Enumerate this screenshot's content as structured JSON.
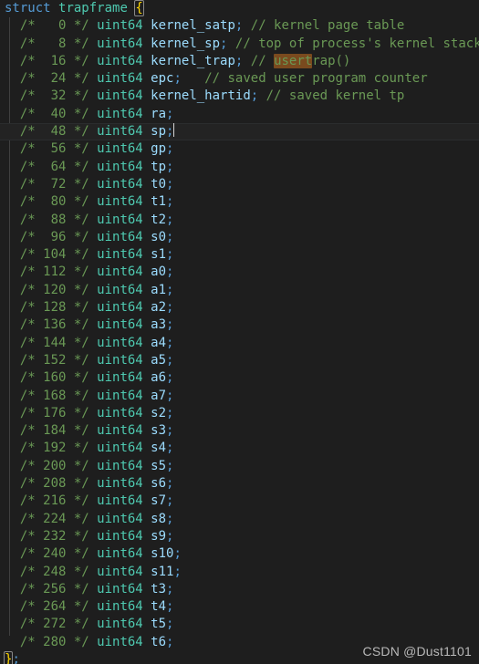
{
  "editor": {
    "language": "c",
    "theme": "dark-plus",
    "background_color": "#1e1e1e",
    "foreground_color": "#d4d4d4",
    "current_line_number": 8,
    "colors": {
      "keyword": "#569cd6",
      "type": "#4ec9b0",
      "comment": "#6a9955",
      "identifier": "#9cdcfe",
      "brace": "#ffd700",
      "find_match_background": "#7a4a1e",
      "indent_guide": "#404040",
      "current_line_border": "#2a2d2e"
    }
  },
  "header": {
    "keyword": "struct",
    "name": "trapframe",
    "open_brace": "{"
  },
  "footer": {
    "close_brace": "}",
    "semicolon": ";"
  },
  "find": {
    "match_text": "usert",
    "match_remainder": "rap()"
  },
  "fields": [
    {
      "offset": "0",
      "type": "uint64",
      "name": "kernel_satp;",
      "comment": "// kernel page table",
      "comment_col": 26,
      "current": false
    },
    {
      "offset": "8",
      "type": "uint64",
      "name": "kernel_sp;",
      "comment": "// top of process's kernel stack",
      "comment_col": 26,
      "current": false
    },
    {
      "offset": "16",
      "type": "uint64",
      "name": "kernel_trap;",
      "comment": "// usertrap()",
      "comment_col": 26,
      "current": false,
      "has_find_match": true
    },
    {
      "offset": "24",
      "type": "uint64",
      "name": "epc;",
      "comment": "// saved user program counter",
      "comment_col": 26,
      "current": false
    },
    {
      "offset": "32",
      "type": "uint64",
      "name": "kernel_hartid;",
      "comment": "// saved kernel tp",
      "comment_col": 26,
      "current": false
    },
    {
      "offset": "40",
      "type": "uint64",
      "name": "ra;",
      "comment": "",
      "comment_col": 26,
      "current": false
    },
    {
      "offset": "48",
      "type": "uint64",
      "name": "sp;",
      "comment": "",
      "comment_col": 26,
      "current": true
    },
    {
      "offset": "56",
      "type": "uint64",
      "name": "gp;",
      "comment": "",
      "comment_col": 26,
      "current": false
    },
    {
      "offset": "64",
      "type": "uint64",
      "name": "tp;",
      "comment": "",
      "comment_col": 26,
      "current": false
    },
    {
      "offset": "72",
      "type": "uint64",
      "name": "t0;",
      "comment": "",
      "comment_col": 26,
      "current": false
    },
    {
      "offset": "80",
      "type": "uint64",
      "name": "t1;",
      "comment": "",
      "comment_col": 26,
      "current": false
    },
    {
      "offset": "88",
      "type": "uint64",
      "name": "t2;",
      "comment": "",
      "comment_col": 26,
      "current": false
    },
    {
      "offset": "96",
      "type": "uint64",
      "name": "s0;",
      "comment": "",
      "comment_col": 26,
      "current": false
    },
    {
      "offset": "104",
      "type": "uint64",
      "name": "s1;",
      "comment": "",
      "comment_col": 26,
      "current": false
    },
    {
      "offset": "112",
      "type": "uint64",
      "name": "a0;",
      "comment": "",
      "comment_col": 26,
      "current": false
    },
    {
      "offset": "120",
      "type": "uint64",
      "name": "a1;",
      "comment": "",
      "comment_col": 26,
      "current": false
    },
    {
      "offset": "128",
      "type": "uint64",
      "name": "a2;",
      "comment": "",
      "comment_col": 26,
      "current": false
    },
    {
      "offset": "136",
      "type": "uint64",
      "name": "a3;",
      "comment": "",
      "comment_col": 26,
      "current": false
    },
    {
      "offset": "144",
      "type": "uint64",
      "name": "a4;",
      "comment": "",
      "comment_col": 26,
      "current": false
    },
    {
      "offset": "152",
      "type": "uint64",
      "name": "a5;",
      "comment": "",
      "comment_col": 26,
      "current": false
    },
    {
      "offset": "160",
      "type": "uint64",
      "name": "a6;",
      "comment": "",
      "comment_col": 26,
      "current": false
    },
    {
      "offset": "168",
      "type": "uint64",
      "name": "a7;",
      "comment": "",
      "comment_col": 26,
      "current": false
    },
    {
      "offset": "176",
      "type": "uint64",
      "name": "s2;",
      "comment": "",
      "comment_col": 26,
      "current": false
    },
    {
      "offset": "184",
      "type": "uint64",
      "name": "s3;",
      "comment": "",
      "comment_col": 26,
      "current": false
    },
    {
      "offset": "192",
      "type": "uint64",
      "name": "s4;",
      "comment": "",
      "comment_col": 26,
      "current": false
    },
    {
      "offset": "200",
      "type": "uint64",
      "name": "s5;",
      "comment": "",
      "comment_col": 26,
      "current": false
    },
    {
      "offset": "208",
      "type": "uint64",
      "name": "s6;",
      "comment": "",
      "comment_col": 26,
      "current": false
    },
    {
      "offset": "216",
      "type": "uint64",
      "name": "s7;",
      "comment": "",
      "comment_col": 26,
      "current": false
    },
    {
      "offset": "224",
      "type": "uint64",
      "name": "s8;",
      "comment": "",
      "comment_col": 26,
      "current": false
    },
    {
      "offset": "232",
      "type": "uint64",
      "name": "s9;",
      "comment": "",
      "comment_col": 26,
      "current": false
    },
    {
      "offset": "240",
      "type": "uint64",
      "name": "s10;",
      "comment": "",
      "comment_col": 26,
      "current": false
    },
    {
      "offset": "248",
      "type": "uint64",
      "name": "s11;",
      "comment": "",
      "comment_col": 26,
      "current": false
    },
    {
      "offset": "256",
      "type": "uint64",
      "name": "t3;",
      "comment": "",
      "comment_col": 26,
      "current": false
    },
    {
      "offset": "264",
      "type": "uint64",
      "name": "t4;",
      "comment": "",
      "comment_col": 26,
      "current": false
    },
    {
      "offset": "272",
      "type": "uint64",
      "name": "t5;",
      "comment": "",
      "comment_col": 26,
      "current": false
    },
    {
      "offset": "280",
      "type": "uint64",
      "name": "t6;",
      "comment": "",
      "comment_col": 26,
      "current": false
    }
  ],
  "watermark": {
    "text": "CSDN @Dust1101"
  }
}
